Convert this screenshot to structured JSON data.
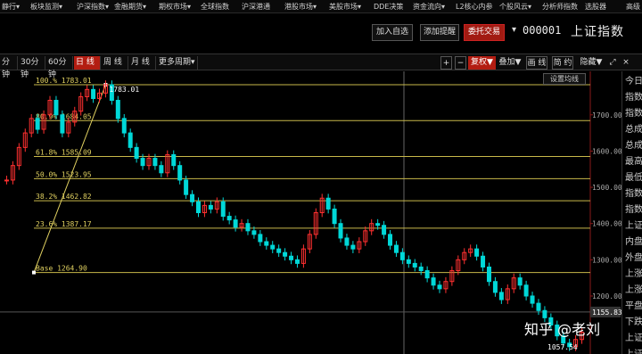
{
  "menubar": {
    "items": [
      "静行▾",
      "板块监测▾",
      "沪深指数▾",
      "金融期货▾",
      "期权市场▾",
      "全球指数",
      "沪深港通",
      "港股市场▾",
      "美股市场▾",
      "DDE决策",
      "资金流向▾",
      "L2核心内参",
      "个股风云▾",
      "分析师指数",
      "选股器",
      "高级"
    ]
  },
  "toolbar": {
    "add_watchlist": "加入自选",
    "add_alert": "添加提醒",
    "trade": "委托交易",
    "arrow": "▾",
    "stock_code": "000001",
    "stock_name": "上证指数"
  },
  "periods": [
    "分钟",
    "30分钟",
    "60分钟",
    "日 线",
    "周 线",
    "月 线",
    "更多周期▾"
  ],
  "active_period": "日 线",
  "chart_tools": {
    "plus": "+",
    "minus": "−",
    "restore": "复权▼",
    "overlay": "叠加▼",
    "line": "画 线",
    "simple": "简 约",
    "hide": "隐藏▼",
    "expand": "⤢",
    "close": "×"
  },
  "ma_setting": "设置均线",
  "chart_data": {
    "type": "line",
    "ylim": [
      1040,
      1820
    ],
    "y_ticks": [
      "1700.00",
      "1600.00",
      "1500.00",
      "1400.00",
      "1300.00",
      "1200.00"
    ],
    "fib_levels": [
      {
        "label": "100.% 1783.01",
        "value": 1783.01
      },
      {
        "label": "80.9% 1684.05",
        "value": 1684.05
      },
      {
        "label": "61.8% 1585.09",
        "value": 1585.09
      },
      {
        "label": "50.0% 1523.95",
        "value": 1523.95
      },
      {
        "label": "38.2% 1462.82",
        "value": 1462.82
      },
      {
        "label": "23.6% 1387.17",
        "value": 1387.17
      },
      {
        "label": "Base  1264.90",
        "value": 1264.9
      }
    ],
    "high_label": "1783.01",
    "low_label": "1057.54",
    "last_price": "1155.83",
    "price_series": [
      1520,
      1560,
      1610,
      1650,
      1690,
      1660,
      1700,
      1740,
      1700,
      1650,
      1680,
      1710,
      1750,
      1770,
      1745,
      1760,
      1783,
      1740,
      1690,
      1650,
      1610,
      1580,
      1560,
      1580,
      1560,
      1540,
      1590,
      1560,
      1520,
      1480,
      1460,
      1430,
      1450,
      1440,
      1460,
      1420,
      1410,
      1390,
      1400,
      1380,
      1370,
      1350,
      1340,
      1330,
      1320,
      1310,
      1300,
      1290,
      1330,
      1370,
      1430,
      1470,
      1440,
      1400,
      1360,
      1340,
      1330,
      1350,
      1380,
      1400,
      1395,
      1370,
      1340,
      1320,
      1300,
      1290,
      1280,
      1270,
      1250,
      1230,
      1220,
      1240,
      1270,
      1300,
      1320,
      1330,
      1310,
      1280,
      1240,
      1210,
      1190,
      1220,
      1250,
      1230,
      1200,
      1180,
      1160,
      1140,
      1120,
      1090,
      1070,
      1060,
      1080,
      1100
    ]
  },
  "right_panel": {
    "labels": [
      "今日",
      "指数",
      "指数",
      "总成",
      "总成",
      "最高",
      "最低",
      "指数",
      "指数",
      "上证",
      "内盘",
      "外盘",
      "上涨",
      "上涨",
      "平盘",
      "下跌",
      "上证",
      "上证"
    ]
  },
  "watermark": "知乎 @老刘"
}
